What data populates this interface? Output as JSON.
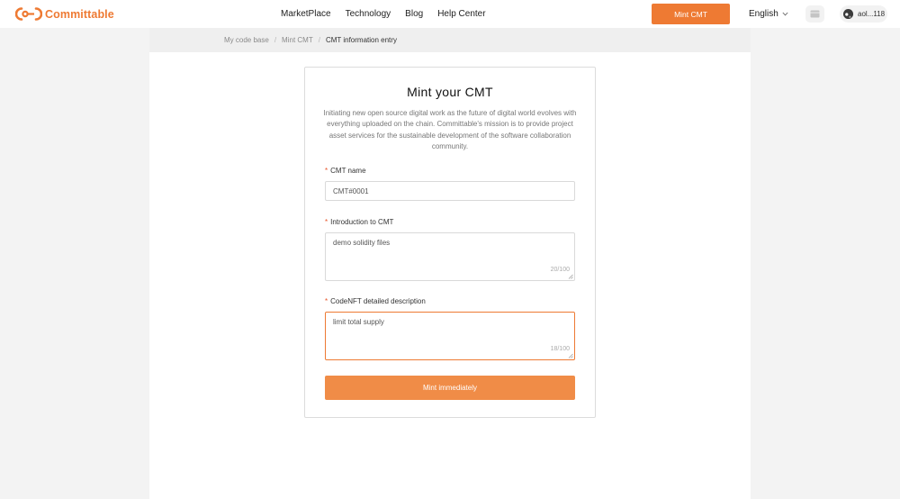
{
  "header": {
    "brand": "Committable",
    "nav": [
      {
        "label": "MarketPlace"
      },
      {
        "label": "Technology"
      },
      {
        "label": "Blog"
      },
      {
        "label": "Help Center"
      }
    ],
    "mint_button": "Mint CMT",
    "language": "English",
    "account_address": "aol...118",
    "icons": {
      "logo": "link-logo-icon",
      "language": "chevron-down-icon",
      "wallet": "wallet-icon",
      "avatar": "avatar-icon"
    }
  },
  "breadcrumb": [
    "My code base",
    "Mint CMT",
    "CMT information entry"
  ],
  "form": {
    "title": "Mint your CMT",
    "description": "Initiating new open source digital work as the future of digital world evolves with everything uploaded on the chain. Committable's mission is to provide project asset services for the sustainable development of the software collaboration community.",
    "required_mark": "*",
    "fields": {
      "name": {
        "label": "CMT name",
        "value": "CMT#0001"
      },
      "intro": {
        "label": "Introduction to CMT",
        "value": "demo solidity files",
        "counter": "20/100"
      },
      "desc": {
        "label": "CodeNFT detailed description",
        "value": "limit total supply",
        "counter": "18/100"
      }
    },
    "submit": "Mint immediately"
  },
  "colors": {
    "brand": "#ee7a33",
    "submit": "#f08c47",
    "background": "#f3f3f3"
  }
}
